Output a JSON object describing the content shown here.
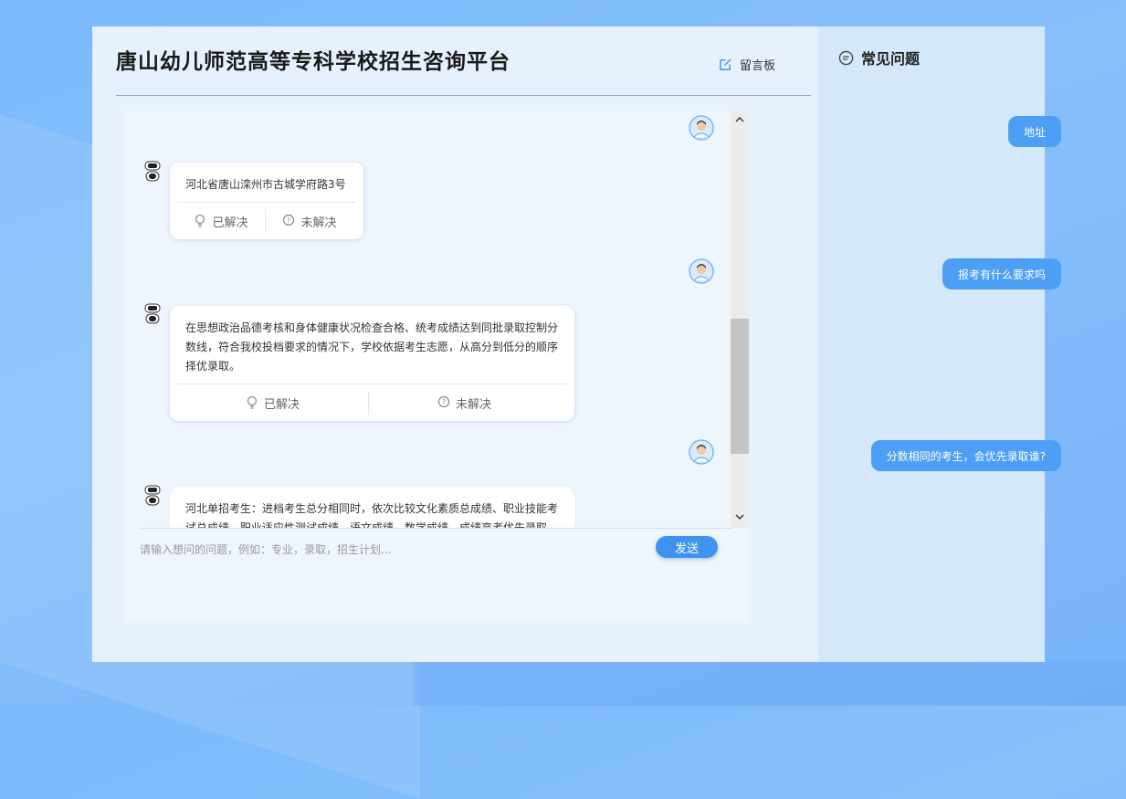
{
  "header": {
    "title": "唐山幼儿师范高等专科学校招生咨询平台",
    "message_board_label": "留言板"
  },
  "sidebar": {
    "faq_title": "常见问题"
  },
  "messages": {
    "m1_user": "地址",
    "m2_bot": "河北省唐山滦州市古城学府路3号",
    "m3_user": "报考有什么要求吗",
    "m4_bot": "在思想政治品德考核和身体健康状况检查合格、统考成绩达到同批录取控制分数线，符合我校投档要求的情况下，学校依据考生志愿，从高分到低分的顺序择优录取。",
    "m5_user": "分数相同的考生，会优先录取谁?",
    "m6_bot": "河北单招考生：进档考生总分相同时，依次比较文化素质总成绩、职业技能考试总成绩、职业适应性测试成绩、语文成绩、数学成绩，成绩高者优先录取。"
  },
  "actions": {
    "solved_label": "已解决",
    "unsolved_label": "未解决"
  },
  "input": {
    "placeholder": "请输入想问的问题，例如：专业，录取，招生计划...",
    "value": ""
  },
  "send_label": "发送",
  "colors": {
    "accent": "#4d9ff5",
    "send": "#3d93ee",
    "panel": "#e6f1fd"
  },
  "icons": [
    "edit-icon",
    "chat-bubble-icon",
    "lightbulb-icon",
    "question-icon",
    "robot-icon",
    "user-avatar-icon",
    "chevron-up-icon",
    "chevron-down-icon"
  ]
}
